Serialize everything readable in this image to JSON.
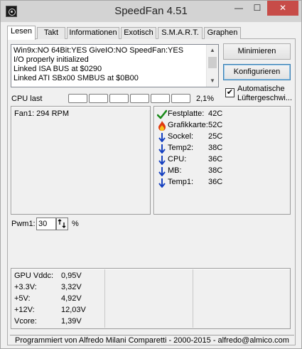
{
  "window": {
    "title": "SpeedFan 4.51",
    "minimize_glyph": "—",
    "maximize_glyph": "☐",
    "close_glyph": "✕"
  },
  "tabs": [
    {
      "label": "Lesen",
      "active": true
    },
    {
      "label": "Takt",
      "active": false
    },
    {
      "label": "Informationen",
      "active": false
    },
    {
      "label": "Exotisch",
      "active": false
    },
    {
      "label": "S.M.A.R.T.",
      "active": false
    },
    {
      "label": "Graphen",
      "active": false
    }
  ],
  "log": {
    "lines": [
      "Win9x:NO  64Bit:YES  GiveIO:NO  SpeedFan:YES",
      "I/O properly initialized",
      "Linked ISA BUS at $0290",
      "Linked ATI SBx00 SMBUS at $0B00"
    ]
  },
  "buttons": {
    "minimize": "Minimieren",
    "configure": "Konfigurieren"
  },
  "auto_fan": {
    "checked": true,
    "check_glyph": "✔",
    "label_line1": "Automatische",
    "label_line2": "Lüftergeschwi..."
  },
  "cpu": {
    "label": "CPU last",
    "percent": "2,1%",
    "load_fraction": 0.021
  },
  "fans": [
    {
      "text": "Fan1: 294 RPM"
    }
  ],
  "temperatures": [
    {
      "name": "Festplatte:",
      "value": "42C",
      "icon": "ok-check-icon"
    },
    {
      "name": "Grafikkarte:",
      "value": "52C",
      "icon": "flame-icon"
    },
    {
      "name": "Sockel:",
      "value": "25C",
      "icon": "arrow-down-icon"
    },
    {
      "name": "Temp2:",
      "value": "38C",
      "icon": "arrow-down-icon"
    },
    {
      "name": "CPU:",
      "value": "36C",
      "icon": "arrow-down-icon"
    },
    {
      "name": "MB:",
      "value": "38C",
      "icon": "arrow-down-icon"
    },
    {
      "name": "Temp1:",
      "value": "36C",
      "icon": "arrow-down-icon"
    }
  ],
  "pwm": {
    "label": "Pwm1:",
    "value": "30",
    "unit": "%"
  },
  "voltages": [
    {
      "name": "GPU Vddc:",
      "value": "0,95V"
    },
    {
      "name": "+3.3V:",
      "value": "3,32V"
    },
    {
      "name": "+5V:",
      "value": "4,92V"
    },
    {
      "name": "+12V:",
      "value": "12,03V"
    },
    {
      "name": "Vcore:",
      "value": "1,39V"
    }
  ],
  "status": {
    "text": "Programmiert von Alfredo Milani Comparetti - 2000-2015 - alfredo@almico.com"
  },
  "colors": {
    "check_green": "#1a8a1a",
    "arrow_blue": "#1540c0",
    "flame_red": "#e03a10",
    "flame_yellow": "#f7c21a",
    "close_red": "#c74c48"
  }
}
